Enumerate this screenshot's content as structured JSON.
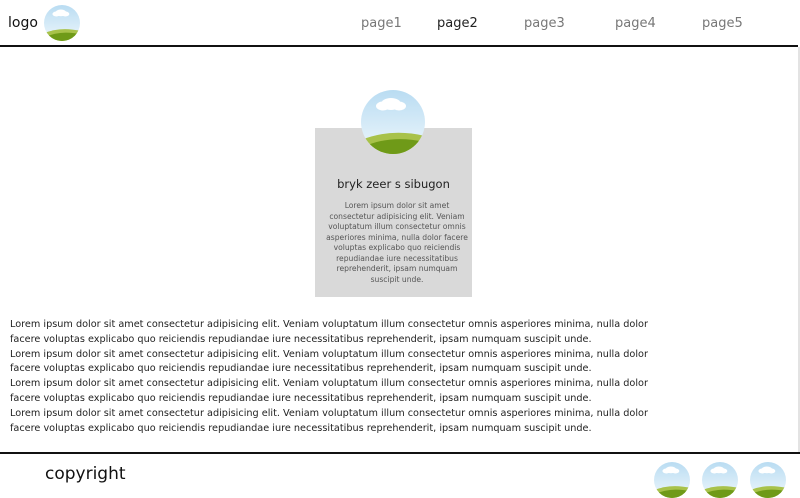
{
  "header": {
    "logo_label": "logo",
    "logo_icon": "landscape-image-icon",
    "nav": [
      {
        "label": "page1",
        "active": false
      },
      {
        "label": "page2",
        "active": true
      },
      {
        "label": "page3",
        "active": false
      },
      {
        "label": "page4",
        "active": false
      },
      {
        "label": "page5",
        "active": false
      }
    ]
  },
  "card": {
    "avatar_icon": "landscape-image-icon",
    "title": "bryk zeer s sibugon",
    "text": "Lorem ipsum dolor sit amet consectetur adipisicing elit. Veniam voluptatum illum consectetur omnis asperiores minima, nulla dolor facere voluptas explicabo quo reiciendis repudiandae iure necessitatibus reprehenderit, ipsam numquam suscipit unde."
  },
  "body": {
    "paragraph": "Lorem ipsum dolor sit amet consectetur adipisicing elit. Veniam voluptatum illum consectetur omnis asperiores minima, nulla dolor facere voluptas explicabo quo reiciendis repudiandae iure necessitatibus reprehenderit, ipsam numquam suscipit unde.",
    "repeat_count": 4
  },
  "footer": {
    "copyright": "copyright",
    "social_icons": [
      "landscape-image-icon",
      "landscape-image-icon",
      "landscape-image-icon"
    ]
  },
  "colors": {
    "sky": "#cfe6f5",
    "cloud": "#ffffff",
    "hill_light": "#a8c24a",
    "hill_dark": "#6f9a18",
    "card_bg": "#d9d9d9",
    "rule": "#111111"
  }
}
